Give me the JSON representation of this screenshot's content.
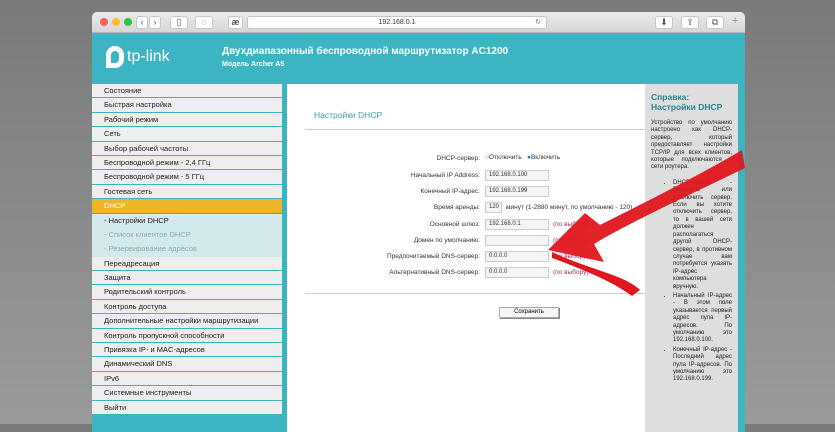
{
  "browser": {
    "url": "192.168.0.1",
    "reader_icon": "æ"
  },
  "header": {
    "brand": "tp-link",
    "title": "Двухдиапазонный беспроводной маршрутизатор AC1200",
    "model": "Модель Archer A5"
  },
  "sidebar": {
    "items": [
      {
        "label": "Состояние"
      },
      {
        "label": "Быстрая настройка"
      },
      {
        "label": "Рабочий режим"
      },
      {
        "label": "Сеть"
      },
      {
        "label": "Выбор рабочей частоты"
      },
      {
        "label": "Беспроводной режим - 2,4 ГГц"
      },
      {
        "label": "Беспроводной режим - 5 ГГц"
      },
      {
        "label": "Гостевая сеть"
      },
      {
        "label": "DHCP"
      },
      {
        "label": "- Настройки DHCP"
      },
      {
        "label": "- Список клиентов DHCP"
      },
      {
        "label": "- Резервирование адресов"
      },
      {
        "label": "Переадресация"
      },
      {
        "label": "Защита"
      },
      {
        "label": "Родительский контроль"
      },
      {
        "label": "Контроль доступа"
      },
      {
        "label": "Дополнительные настройки маршрутизации"
      },
      {
        "label": "Контроль пропускной способности"
      },
      {
        "label": "Привязка IP- и MAC-адресов"
      },
      {
        "label": "Динамический DNS"
      },
      {
        "label": "IPv6"
      },
      {
        "label": "Системные инструменты"
      },
      {
        "label": "Выйти"
      }
    ]
  },
  "main": {
    "title": "Настройки DHCP",
    "dhcp_label": "DHCP-сервер:",
    "off": "Отключить",
    "on": "Включить",
    "fields": [
      {
        "label": "Начальный IP Address:",
        "value": "192.168.0.100",
        "hint": ""
      },
      {
        "label": "Конечный IP-адрес:",
        "value": "192.168.0.199",
        "hint": ""
      },
      {
        "label": "Время аренды:",
        "value": "120",
        "hint": "минут (1-2880 минут, по умолчанию - 120)"
      },
      {
        "label": "Основной шлюз:",
        "value": "192.168.0.1",
        "hint": "(по выбору)"
      },
      {
        "label": "Домен по умолчанию:",
        "value": "",
        "hint": "(по выбору)"
      },
      {
        "label": "Предпочитаемый DNS-сервер:",
        "value": "0.0.0.0",
        "hint": "(по выбору)"
      },
      {
        "label": "Альтернативный DNS-сервер:",
        "value": "0.0.0.0",
        "hint": "(по выбору)"
      }
    ],
    "save": "Сохранить"
  },
  "help": {
    "title": "Справка: Настройки DHCP",
    "intro": "Устройство по умолчанию настроено как DHCP-сервер, который предоставляет настройки TCP/IP для всех клиентов, которые подключаются к сети роутера.",
    "items": [
      "DHCP-сервер - Включить или Отключить сервер. Если вы хотите отключить сервер, то в вашей сети должен располагаться другой DHCP-сервер, в противном случае вам потребуется указать IP-адрес компьютера вручную.",
      "Начальный IP-адрес - В этом поле указывается первый адрес пула IP-адресов. По умолчанию это 192.168.0.100.",
      "Конечный IP-адрес - Последний адрес пула IP-адресов. По умолчанию это 192.168.0.199."
    ]
  },
  "colors": {
    "teal": "#3cb4c1",
    "active": "#f0b429",
    "arrow": "#e0161e"
  }
}
